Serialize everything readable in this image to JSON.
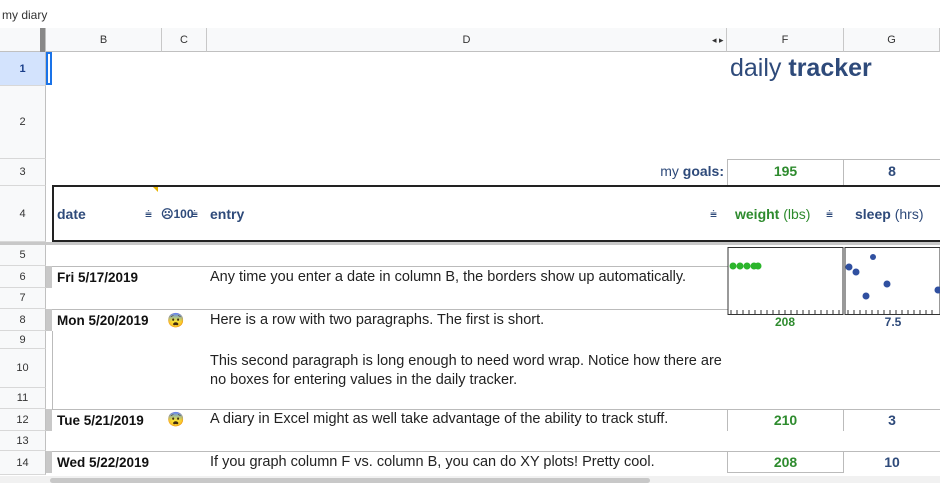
{
  "app": {
    "doc_title": "my diary"
  },
  "columns": {
    "b": "B",
    "c": "C",
    "d": "D",
    "f": "F",
    "g": "G",
    "arrows": "◂ ▸"
  },
  "rows": [
    "1",
    "2",
    "3",
    "4",
    "5",
    "6",
    "7",
    "8",
    "9",
    "10",
    "11",
    "12",
    "13",
    "14"
  ],
  "tracker": {
    "title_light": "daily ",
    "title_bold": "tracker"
  },
  "goals": {
    "label_prefix": "my ",
    "label_bold": "goals:",
    "weight": "195",
    "sleep": "8"
  },
  "header": {
    "date": "date",
    "mood": "☹100",
    "entry": "entry",
    "weight_bold": "weight",
    "weight_unit": " (lbs)",
    "sleep_bold": "sleep",
    "sleep_unit": " (hrs)"
  },
  "entries": [
    {
      "date": "Fri 5/17/2019",
      "text": "Any time you enter a date in column B, the borders show up automatically."
    },
    {
      "date": "Mon 5/20/2019",
      "emoji": "😨",
      "text": "Here is a row with two paragraphs. The first is short.",
      "text2": "This second paragraph is long enough to need word wrap. Notice how there are no boxes for entering values in the daily tracker."
    },
    {
      "date": "Tue 5/21/2019",
      "emoji": "😨",
      "text": "A diary in Excel might as well take advantage of the ability to track stuff.",
      "weight": "210",
      "sleep": "3"
    },
    {
      "date": "Wed 5/22/2019",
      "text": "If you graph column F vs. column B, you can do XY plots! Pretty cool.",
      "weight": "208",
      "sleep": "10"
    }
  ],
  "sparkline_labels": {
    "weight": "208",
    "sleep": "7.5"
  },
  "colors": {
    "accent_green": "#2e8b2e",
    "accent_blue": "#2e4a7a",
    "selection": "#1a73e8"
  }
}
